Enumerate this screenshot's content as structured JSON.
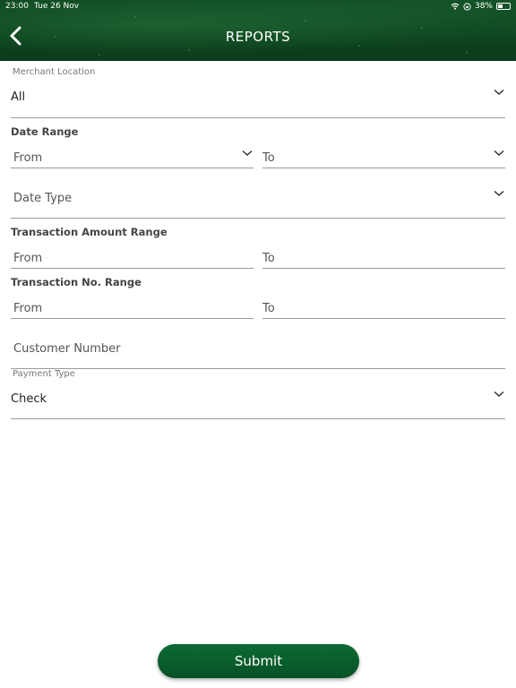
{
  "status_bar": {
    "time": "23:00",
    "date": "Tue 26 Nov",
    "battery": "38%",
    "battery_level": 0.38
  },
  "header": {
    "title": "REPORTS",
    "back_icon": "chevron-left-icon"
  },
  "form": {
    "merchant_location": {
      "label": "Merchant Location",
      "value": "All"
    },
    "date_range": {
      "label": "Date Range",
      "from_placeholder": "From",
      "to_placeholder": "To"
    },
    "date_type": {
      "placeholder": "Date Type"
    },
    "transaction_amount_range": {
      "label": "Transaction Amount Range",
      "from_placeholder": "From",
      "to_placeholder": "To"
    },
    "transaction_no_range": {
      "label": "Transaction No. Range",
      "from_placeholder": "From",
      "to_placeholder": "To"
    },
    "customer_number": {
      "placeholder": "Customer Number"
    },
    "payment_type": {
      "label": "Payment Type",
      "value": "Check"
    }
  },
  "submit": {
    "label": "Submit"
  },
  "colors": {
    "header_green": "#0b3b1b",
    "button_green": "#0c6a33",
    "underline": "#9a9a9a"
  }
}
